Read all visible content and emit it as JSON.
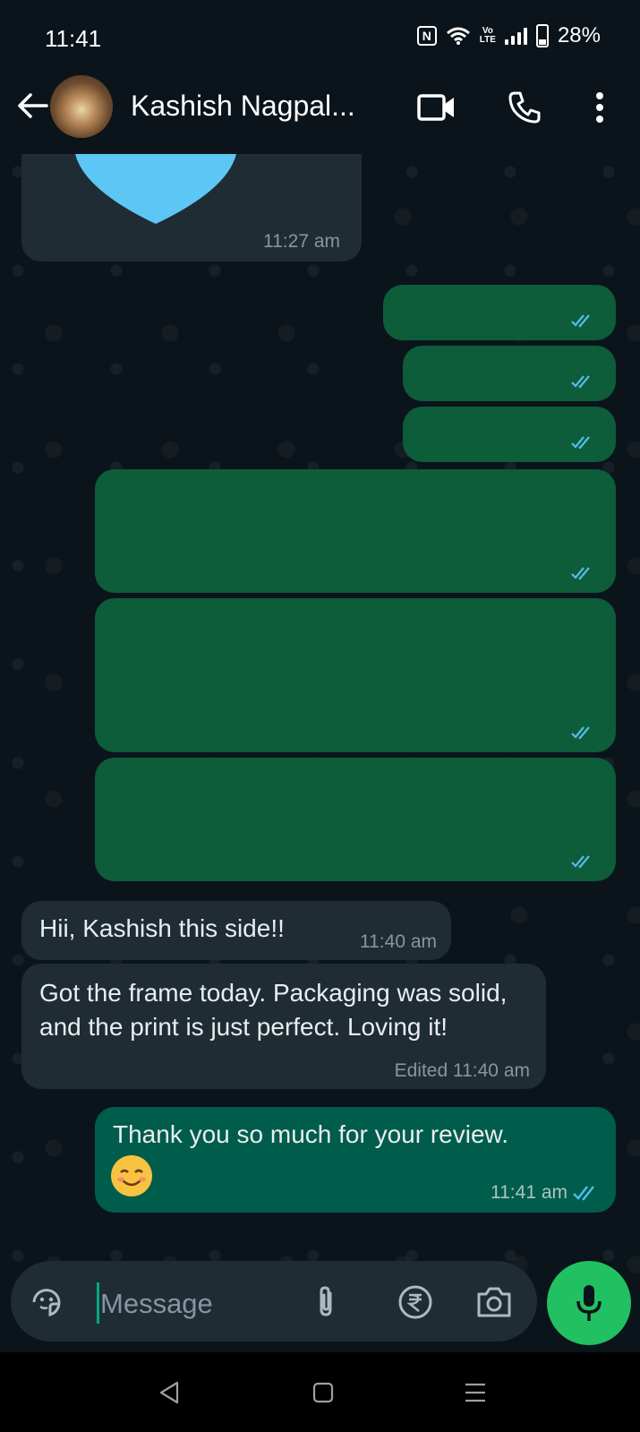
{
  "status_bar": {
    "time": "11:41",
    "volte": "Vo\nLTE",
    "battery": "28%"
  },
  "header": {
    "contact_name": "Kashish Nagpal...",
    "icons": [
      "back-arrow-icon",
      "video-call-icon",
      "voice-call-icon",
      "more-options-icon"
    ]
  },
  "messages": [
    {
      "direction": "incoming",
      "kind": "image",
      "time": "11:27 am"
    },
    {
      "direction": "outgoing",
      "kind": "redacted"
    },
    {
      "direction": "outgoing",
      "kind": "redacted"
    },
    {
      "direction": "outgoing",
      "kind": "redacted"
    },
    {
      "direction": "outgoing",
      "kind": "redacted"
    },
    {
      "direction": "outgoing",
      "kind": "redacted"
    },
    {
      "direction": "outgoing",
      "kind": "redacted"
    },
    {
      "direction": "incoming",
      "kind": "text",
      "text": "Hii, Kashish this side!!",
      "time": "11:40 am"
    },
    {
      "direction": "incoming",
      "kind": "text",
      "text": "Got the frame today. Packaging was solid, and the print is just perfect. Loving it!",
      "time": "Edited 11:40 am"
    },
    {
      "direction": "outgoing",
      "kind": "text",
      "text": "Thank you so much for your review.",
      "emoji": "☺️",
      "time": "11:41 am"
    }
  ],
  "composer": {
    "placeholder": "Message",
    "icons": [
      "sticker-icon",
      "attach-icon",
      "rupee-payment-icon",
      "camera-icon",
      "mic-icon"
    ]
  },
  "colors": {
    "background": "#0b141a",
    "incoming_bubble": "#1f2c33",
    "outgoing_bubble": "#005c4b",
    "accent_green": "#21c063",
    "read_tick_blue": "#53bdeb"
  }
}
